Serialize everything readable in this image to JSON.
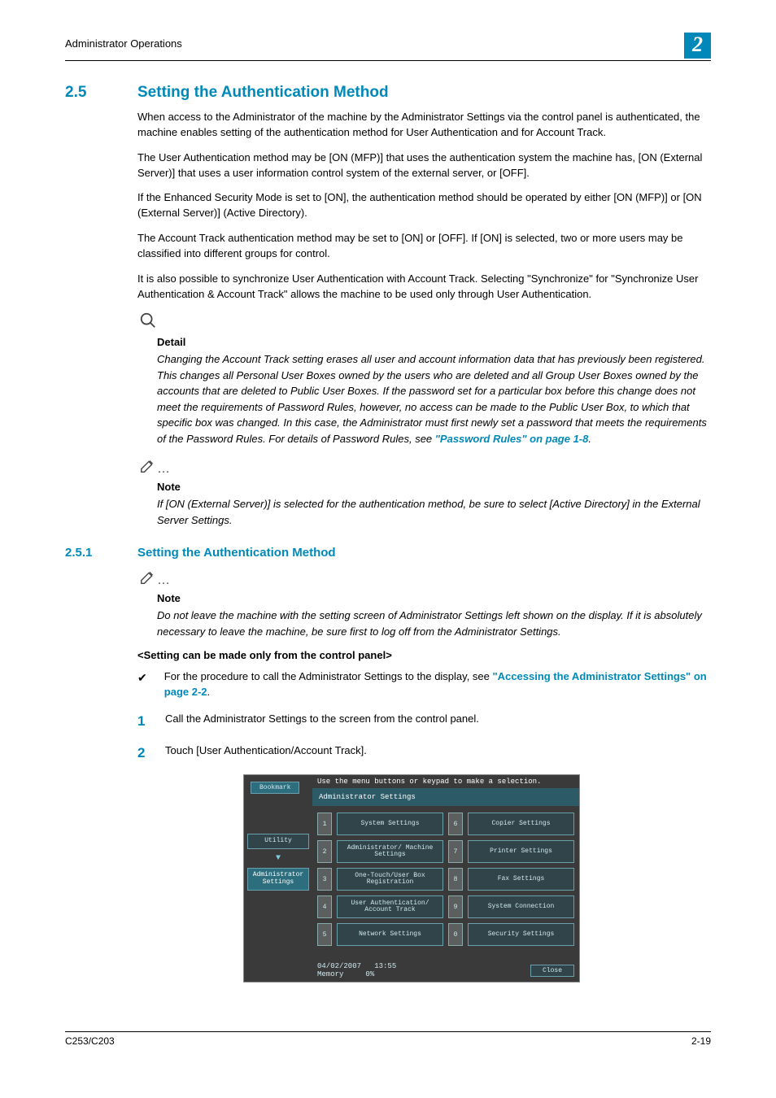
{
  "header": {
    "left": "Administrator Operations",
    "chapter": "2"
  },
  "section": {
    "num": "2.5",
    "title": "Setting the Authentication Method",
    "paras": [
      "When access to the Administrator of the machine by the Administrator Settings via the control panel is authenticated, the machine enables setting of the authentication method for User Authentication and for Account Track.",
      "The User Authentication method may be [ON (MFP)] that uses the authentication system the machine has, [ON (External Server)] that uses a user information control system of the external server, or [OFF].",
      "If the Enhanced Security Mode is set to [ON], the authentication method should be operated by either [ON (MFP)] or [ON (External Server)] (Active Directory).",
      "The Account Track authentication method may be set to [ON] or [OFF]. If [ON] is selected, two or more users may be classified into different groups for control.",
      "It is also possible to synchronize User Authentication with Account Track. Selecting \"Synchronize\" for \"Synchronize User Authentication & Account Track\" allows the machine to be used only through User Authentication."
    ]
  },
  "detail": {
    "title": "Detail",
    "body_pre": "Changing the Account Track setting erases all user and account information data that has previously been registered. This changes all Personal User Boxes owned by the users who are deleted and all Group User Boxes owned by the accounts that are deleted to Public User Boxes. If the password set for a particular box before this change does not meet the requirements of Password Rules, however, no access can be made to the Public User Box, to which that specific box was changed. In this case, the Administrator must first newly set a password that meets the requirements of the Password Rules. For details of Password Rules, see ",
    "link": "\"Password Rules\" on page 1-8",
    "body_post": "."
  },
  "note1": {
    "title": "Note",
    "body": "If [ON (External Server)] is selected for the authentication method, be sure to select [Active Directory] in the External Server Settings."
  },
  "subsection": {
    "num": "2.5.1",
    "title": "Setting the Authentication Method"
  },
  "note2": {
    "title": "Note",
    "body": "Do not leave the machine with the setting screen of Administrator Settings left shown on the display. If it is absolutely necessary to leave the machine, be sure first to log off from the Administrator Settings."
  },
  "subhead": "<Setting can be made only from the control panel>",
  "check": {
    "pre": "For the procedure to call the Administrator Settings to the display, see ",
    "link": "\"Accessing the Administrator Settings\" on page 2-2",
    "post": "."
  },
  "steps": {
    "s1": "Call the Administrator Settings to the screen from the control panel.",
    "s2": "Touch [User Authentication/Account Track]."
  },
  "panel": {
    "hint": "Use the menu buttons or keypad to make a selection.",
    "bookmark": "Bookmark",
    "titlebar": "Administrator Settings",
    "tabs": {
      "utility": "Utility",
      "admin": "Administrator Settings"
    },
    "menu": [
      {
        "n": "1",
        "label": "System Settings"
      },
      {
        "n": "2",
        "label": "Administrator/\nMachine Settings"
      },
      {
        "n": "3",
        "label": "One-Touch/User Box\nRegistration"
      },
      {
        "n": "4",
        "label": "User Authentication/\nAccount Track"
      },
      {
        "n": "5",
        "label": "Network Settings"
      },
      {
        "n": "6",
        "label": "Copier Settings"
      },
      {
        "n": "7",
        "label": "Printer Settings"
      },
      {
        "n": "8",
        "label": "Fax Settings"
      },
      {
        "n": "9",
        "label": "System Connection"
      },
      {
        "n": "0",
        "label": "Security Settings"
      }
    ],
    "footer": {
      "date": "04/02/2007",
      "time": "13:55",
      "mem_label": "Memory",
      "mem_val": "0%",
      "close": "Close"
    }
  },
  "footer": {
    "left": "C253/C203",
    "right": "2-19"
  }
}
